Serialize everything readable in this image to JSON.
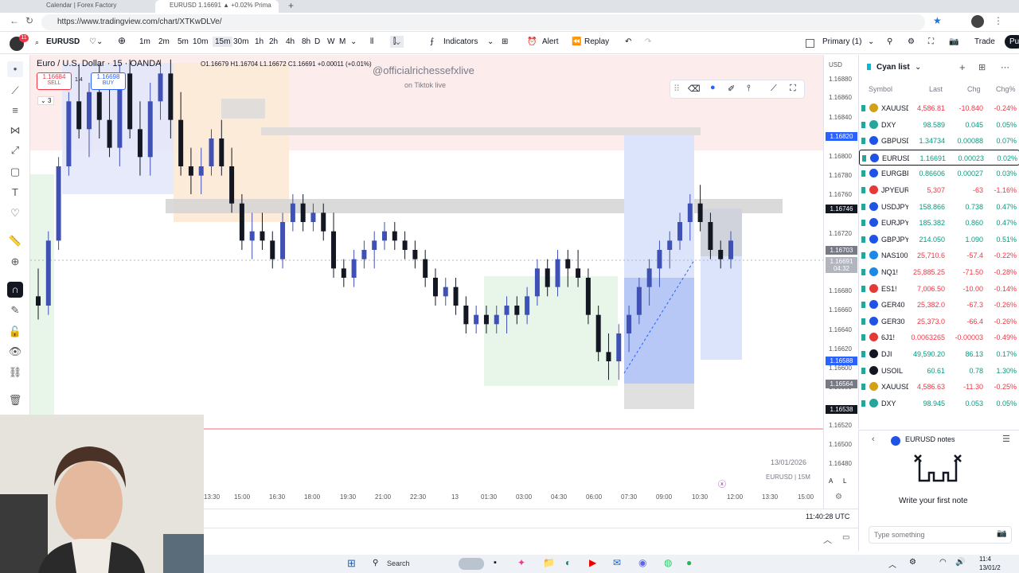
{
  "browser": {
    "tabs": [
      "Calendar | Forex Factory",
      "EURUSD 1.16691 ▲ +0.02% Prima"
    ],
    "url": "https://www.tradingview.com/chart/XTKwDLVe/"
  },
  "toolbar": {
    "avatar_badge": "11",
    "symbol": "EURUSD",
    "intervals": [
      "1m",
      "2m",
      "5m",
      "10m",
      "15m",
      "30m",
      "1h",
      "2h",
      "4h",
      "8h",
      "D",
      "W",
      "M"
    ],
    "active_interval": "15m",
    "indicators": "Indicators",
    "alert": "Alert",
    "replay": "Replay",
    "layout": "Primary (1)",
    "trade": "Trade",
    "publish": "Pu"
  },
  "chart": {
    "title": "Euro / U.S. Dollar · 15 · OANDA",
    "ohlc": "O1.16679 H1.16704 L1.16672 C1.16691 +0.00011 (+0.01%)",
    "sell_price": "1.16684",
    "sell_label": "SELL",
    "buy_price": "1.16698",
    "buy_label": "BUY",
    "spread": "1.4",
    "collapse_count": "3",
    "watermark": "@officialrichessefxlive",
    "watermark_sub": "on Tiktok live",
    "date_label": "13/01/2026",
    "symbol_interval": "EURUSD | 15M",
    "currency": "USD",
    "utc_time": "11:40:28 UTC",
    "axis_a": "A",
    "axis_l": "L"
  },
  "price_labels": [
    "1.16880",
    "1.16860",
    "1.16840",
    "1.16800",
    "1.16780",
    "1.16760",
    "1.16720",
    "1.16680",
    "1.16660",
    "1.16640",
    "1.16620",
    "1.16600",
    "1.16580",
    "1.16520",
    "1.16500",
    "1.16480"
  ],
  "price_tags": [
    {
      "text": "1.16820",
      "color": "#2962ff"
    },
    {
      "text": "1.16746",
      "color": "#131722"
    },
    {
      "text": "1.16703",
      "color": "#787b86"
    },
    {
      "text": "1.16691",
      "color": "#b2b5be"
    },
    {
      "text": "04:32",
      "color": "#b2b5be"
    },
    {
      "text": "1.16588",
      "color": "#2962ff"
    },
    {
      "text": "1.16564",
      "color": "#787b86"
    },
    {
      "text": "1.16538",
      "color": "#131722"
    }
  ],
  "time_labels": [
    "13:30",
    "15:00",
    "16:30",
    "18:00",
    "19:30",
    "21:00",
    "22:30",
    "13",
    "01:30",
    "03:00",
    "04:30",
    "06:00",
    "07:30",
    "09:00",
    "10:30",
    "12:00",
    "13:30",
    "15:00"
  ],
  "chart_data": {
    "type": "candlestick",
    "title": "Euro / U.S. Dollar · 15 · OANDA",
    "ylim": [
      1.1647,
      1.1689
    ],
    "candles": [
      {
        "o": 1.1663,
        "h": 1.1666,
        "l": 1.16605,
        "c": 1.1662
      },
      {
        "o": 1.1662,
        "h": 1.167,
        "l": 1.1661,
        "c": 1.1669
      },
      {
        "o": 1.1669,
        "h": 1.1678,
        "l": 1.1668,
        "c": 1.1677
      },
      {
        "o": 1.1677,
        "h": 1.1685,
        "l": 1.1676,
        "c": 1.1684
      },
      {
        "o": 1.1684,
        "h": 1.1688,
        "l": 1.168,
        "c": 1.1681
      },
      {
        "o": 1.1681,
        "h": 1.1686,
        "l": 1.1678,
        "c": 1.1685
      },
      {
        "o": 1.1685,
        "h": 1.1688,
        "l": 1.168,
        "c": 1.1682
      },
      {
        "o": 1.1682,
        "h": 1.1686,
        "l": 1.1678,
        "c": 1.1679
      },
      {
        "o": 1.1679,
        "h": 1.1688,
        "l": 1.1677,
        "c": 1.1687
      },
      {
        "o": 1.1687,
        "h": 1.16885,
        "l": 1.168,
        "c": 1.1681
      },
      {
        "o": 1.1681,
        "h": 1.1684,
        "l": 1.1676,
        "c": 1.1678
      },
      {
        "o": 1.1678,
        "h": 1.1686,
        "l": 1.1676,
        "c": 1.1684
      },
      {
        "o": 1.1684,
        "h": 1.16885,
        "l": 1.1682,
        "c": 1.1687
      },
      {
        "o": 1.1687,
        "h": 1.16885,
        "l": 1.168,
        "c": 1.1682
      },
      {
        "o": 1.1682,
        "h": 1.1685,
        "l": 1.1676,
        "c": 1.1677
      },
      {
        "o": 1.1677,
        "h": 1.1679,
        "l": 1.1674,
        "c": 1.1676
      },
      {
        "o": 1.1676,
        "h": 1.1679,
        "l": 1.1674,
        "c": 1.1677
      },
      {
        "o": 1.1677,
        "h": 1.1681,
        "l": 1.1676,
        "c": 1.168
      },
      {
        "o": 1.168,
        "h": 1.1682,
        "l": 1.1676,
        "c": 1.1677
      },
      {
        "o": 1.1677,
        "h": 1.1679,
        "l": 1.1672,
        "c": 1.1673
      },
      {
        "o": 1.1673,
        "h": 1.1674,
        "l": 1.1668,
        "c": 1.1669
      },
      {
        "o": 1.1669,
        "h": 1.1672,
        "l": 1.1667,
        "c": 1.167
      },
      {
        "o": 1.167,
        "h": 1.1672,
        "l": 1.1668,
        "c": 1.1669
      },
      {
        "o": 1.1669,
        "h": 1.167,
        "l": 1.1666,
        "c": 1.1667
      },
      {
        "o": 1.1667,
        "h": 1.1672,
        "l": 1.1666,
        "c": 1.1671
      },
      {
        "o": 1.1671,
        "h": 1.1674,
        "l": 1.167,
        "c": 1.1673
      },
      {
        "o": 1.1673,
        "h": 1.1674,
        "l": 1.167,
        "c": 1.1671
      },
      {
        "o": 1.1671,
        "h": 1.1673,
        "l": 1.167,
        "c": 1.1672
      },
      {
        "o": 1.1672,
        "h": 1.1673,
        "l": 1.1669,
        "c": 1.167
      },
      {
        "o": 1.167,
        "h": 1.1672,
        "l": 1.1665,
        "c": 1.1666
      },
      {
        "o": 1.1666,
        "h": 1.1667,
        "l": 1.1664,
        "c": 1.1665
      },
      {
        "o": 1.1665,
        "h": 1.1668,
        "l": 1.1664,
        "c": 1.1667
      },
      {
        "o": 1.1667,
        "h": 1.1669,
        "l": 1.1666,
        "c": 1.1668
      },
      {
        "o": 1.1668,
        "h": 1.167,
        "l": 1.1666,
        "c": 1.1669
      },
      {
        "o": 1.1669,
        "h": 1.1671,
        "l": 1.1668,
        "c": 1.167
      },
      {
        "o": 1.167,
        "h": 1.1671,
        "l": 1.1668,
        "c": 1.1669
      },
      {
        "o": 1.1669,
        "h": 1.167,
        "l": 1.1667,
        "c": 1.1668
      },
      {
        "o": 1.1668,
        "h": 1.1669,
        "l": 1.1666,
        "c": 1.1667
      },
      {
        "o": 1.1667,
        "h": 1.1668,
        "l": 1.1664,
        "c": 1.1665
      },
      {
        "o": 1.1665,
        "h": 1.1666,
        "l": 1.1662,
        "c": 1.1663
      },
      {
        "o": 1.1663,
        "h": 1.1665,
        "l": 1.1662,
        "c": 1.1664
      },
      {
        "o": 1.1664,
        "h": 1.1665,
        "l": 1.1661,
        "c": 1.1662
      },
      {
        "o": 1.1662,
        "h": 1.1663,
        "l": 1.1659,
        "c": 1.166
      },
      {
        "o": 1.166,
        "h": 1.1662,
        "l": 1.1659,
        "c": 1.1661
      },
      {
        "o": 1.1661,
        "h": 1.1662,
        "l": 1.1659,
        "c": 1.166
      },
      {
        "o": 1.166,
        "h": 1.1662,
        "l": 1.1659,
        "c": 1.1661
      },
      {
        "o": 1.1661,
        "h": 1.1663,
        "l": 1.1659,
        "c": 1.1662
      },
      {
        "o": 1.1662,
        "h": 1.1663,
        "l": 1.166,
        "c": 1.1661
      },
      {
        "o": 1.1661,
        "h": 1.1664,
        "l": 1.166,
        "c": 1.1663
      },
      {
        "o": 1.1663,
        "h": 1.1667,
        "l": 1.1662,
        "c": 1.1666
      },
      {
        "o": 1.1666,
        "h": 1.1667,
        "l": 1.1663,
        "c": 1.1664
      },
      {
        "o": 1.1664,
        "h": 1.1668,
        "l": 1.1663,
        "c": 1.1667
      },
      {
        "o": 1.1667,
        "h": 1.1668,
        "l": 1.1664,
        "c": 1.1666
      },
      {
        "o": 1.1666,
        "h": 1.1668,
        "l": 1.1664,
        "c": 1.1665
      },
      {
        "o": 1.1665,
        "h": 1.1666,
        "l": 1.166,
        "c": 1.1661
      },
      {
        "o": 1.1661,
        "h": 1.1662,
        "l": 1.1656,
        "c": 1.1657
      },
      {
        "o": 1.1657,
        "h": 1.1659,
        "l": 1.1654,
        "c": 1.1656
      },
      {
        "o": 1.1656,
        "h": 1.166,
        "l": 1.1654,
        "c": 1.1659
      },
      {
        "o": 1.1659,
        "h": 1.1662,
        "l": 1.1657,
        "c": 1.1661
      },
      {
        "o": 1.1661,
        "h": 1.1665,
        "l": 1.166,
        "c": 1.1664
      },
      {
        "o": 1.1664,
        "h": 1.1667,
        "l": 1.1662,
        "c": 1.1666
      },
      {
        "o": 1.1666,
        "h": 1.1669,
        "l": 1.1664,
        "c": 1.1668
      },
      {
        "o": 1.1668,
        "h": 1.167,
        "l": 1.1666,
        "c": 1.1669
      },
      {
        "o": 1.1669,
        "h": 1.1672,
        "l": 1.1668,
        "c": 1.1671
      },
      {
        "o": 1.1671,
        "h": 1.1674,
        "l": 1.1669,
        "c": 1.1673
      },
      {
        "o": 1.1673,
        "h": 1.1675,
        "l": 1.167,
        "c": 1.1671
      },
      {
        "o": 1.1671,
        "h": 1.1672,
        "l": 1.1667,
        "c": 1.1668
      },
      {
        "o": 1.1668,
        "h": 1.1669,
        "l": 1.1666,
        "c": 1.1667
      },
      {
        "o": 1.1667,
        "h": 1.167,
        "l": 1.1666,
        "c": 1.1669
      }
    ]
  },
  "watchlist": {
    "title": "Cyan list",
    "headers": [
      "Symbol",
      "Last",
      "Chg",
      "Chg%"
    ],
    "rows": [
      {
        "sym": "XAUUSD",
        "last": "4,586.81",
        "chg": "-10.840",
        "chgp": "-0.24%",
        "up": false,
        "icon": "#d4a017"
      },
      {
        "sym": "DXY",
        "last": "98.589",
        "chg": "0.045",
        "chgp": "0.05%",
        "up": true,
        "icon": "#26a69a"
      },
      {
        "sym": "GBPUSD",
        "last": "1.34734",
        "chg": "0.00088",
        "chgp": "0.07%",
        "up": true,
        "icon": "#1e53e5"
      },
      {
        "sym": "EURUSD",
        "last": "1.16691",
        "chg": "0.00023",
        "chgp": "0.02%",
        "up": true,
        "icon": "#1e53e5"
      },
      {
        "sym": "EURGBP",
        "last": "0.86606",
        "chg": "0.00027",
        "chgp": "0.03%",
        "up": true,
        "icon": "#1e53e5"
      },
      {
        "sym": "JPYEUR",
        "last": "5,307",
        "chg": "-63",
        "chgp": "-1.16%",
        "up": false,
        "icon": "#e53935"
      },
      {
        "sym": "USDJPY",
        "last": "158.866",
        "chg": "0.738",
        "chgp": "0.47%",
        "up": true,
        "icon": "#1e53e5"
      },
      {
        "sym": "EURJPY",
        "last": "185.382",
        "chg": "0.860",
        "chgp": "0.47%",
        "up": true,
        "icon": "#1e53e5"
      },
      {
        "sym": "GBPJPY",
        "last": "214.050",
        "chg": "1.090",
        "chgp": "0.51%",
        "up": true,
        "icon": "#1e53e5"
      },
      {
        "sym": "NAS100",
        "last": "25,710.6",
        "chg": "-57.4",
        "chgp": "-0.22%",
        "up": false,
        "icon": "#1e88e5"
      },
      {
        "sym": "NQ1!",
        "last": "25,885.25",
        "chg": "-71.50",
        "chgp": "-0.28%",
        "up": false,
        "icon": "#1e88e5"
      },
      {
        "sym": "ES1!",
        "last": "7,006.50",
        "chg": "-10.00",
        "chgp": "-0.14%",
        "up": false,
        "icon": "#e53935"
      },
      {
        "sym": "GER40",
        "last": "25,382.0",
        "chg": "-67.3",
        "chgp": "-0.26%",
        "up": false,
        "icon": "#1e53e5"
      },
      {
        "sym": "GER30",
        "last": "25,373.0",
        "chg": "-66.4",
        "chgp": "-0.26%",
        "up": false,
        "icon": "#1e53e5"
      },
      {
        "sym": "6J1!",
        "last": "0.0063265",
        "chg": "-0.00003",
        "chgp": "-0.49%",
        "up": false,
        "icon": "#e53935"
      },
      {
        "sym": "DJI",
        "last": "49,590.20",
        "chg": "86.13",
        "chgp": "0.17%",
        "up": true,
        "icon": "#131722"
      },
      {
        "sym": "USOIL",
        "last": "60.61",
        "chg": "0.78",
        "chgp": "1.30%",
        "up": true,
        "icon": "#131722"
      },
      {
        "sym": "XAUUSD",
        "last": "4,586.63",
        "chg": "-11.30",
        "chgp": "-0.25%",
        "up": false,
        "icon": "#d4a017"
      },
      {
        "sym": "DXY",
        "last": "98.945",
        "chg": "0.053",
        "chgp": "0.05%",
        "up": true,
        "icon": "#26a69a"
      }
    ]
  },
  "notes": {
    "title": "EURUSD notes",
    "empty_text": "Write your first note",
    "placeholder": "Type something"
  },
  "taskbar": {
    "search": "Search",
    "time": "11:4",
    "date": "13/01/2"
  }
}
